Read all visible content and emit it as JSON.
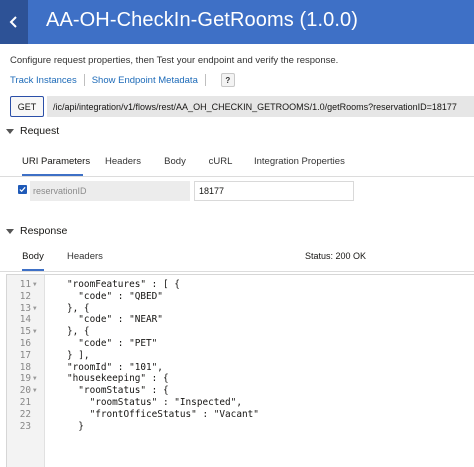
{
  "header": {
    "title": "AA-OH-CheckIn-GetRooms (1.0.0)"
  },
  "intro": {
    "instructions": "Configure request properties, then Test your endpoint and verify the response.",
    "links": {
      "track_instances": "Track Instances",
      "show_metadata": "Show Endpoint Metadata",
      "help": "?"
    }
  },
  "request_bar": {
    "method": "GET",
    "url": "/ic/api/integration/v1/flows/rest/AA_OH_CHECKIN_GETROOMS/1.0/getRooms?reservationID=18177"
  },
  "request": {
    "section_label": "Request",
    "tabs": [
      "URI Parameters",
      "Headers",
      "Body",
      "cURL",
      "Integration Properties"
    ],
    "active_tab": "URI Parameters",
    "param": {
      "checked": true,
      "name": "reservationID",
      "value": "18177"
    }
  },
  "response": {
    "section_label": "Response",
    "tabs": [
      "Body",
      "Headers"
    ],
    "active_tab": "Body",
    "status": "Status: 200 OK",
    "lines": [
      {
        "n": "11",
        "fold": true,
        "text": "\"roomFeatures\" : [ {"
      },
      {
        "n": "12",
        "fold": false,
        "text": "  \"code\" : \"QBED\""
      },
      {
        "n": "13",
        "fold": true,
        "text": "}, {"
      },
      {
        "n": "14",
        "fold": false,
        "text": "  \"code\" : \"NEAR\""
      },
      {
        "n": "15",
        "fold": true,
        "text": "}, {"
      },
      {
        "n": "16",
        "fold": false,
        "text": "  \"code\" : \"PET\""
      },
      {
        "n": "17",
        "fold": false,
        "text": "} ],"
      },
      {
        "n": "18",
        "fold": false,
        "text": "\"roomId\" : \"101\","
      },
      {
        "n": "19",
        "fold": true,
        "text": "\"housekeeping\" : {"
      },
      {
        "n": "20",
        "fold": true,
        "text": "  \"roomStatus\" : {"
      },
      {
        "n": "21",
        "fold": false,
        "text": "    \"roomStatus\" : \"Inspected\","
      },
      {
        "n": "22",
        "fold": false,
        "text": "    \"frontOfficeStatus\" : \"Vacant\""
      },
      {
        "n": "23",
        "fold": false,
        "text": "  }"
      }
    ]
  }
}
